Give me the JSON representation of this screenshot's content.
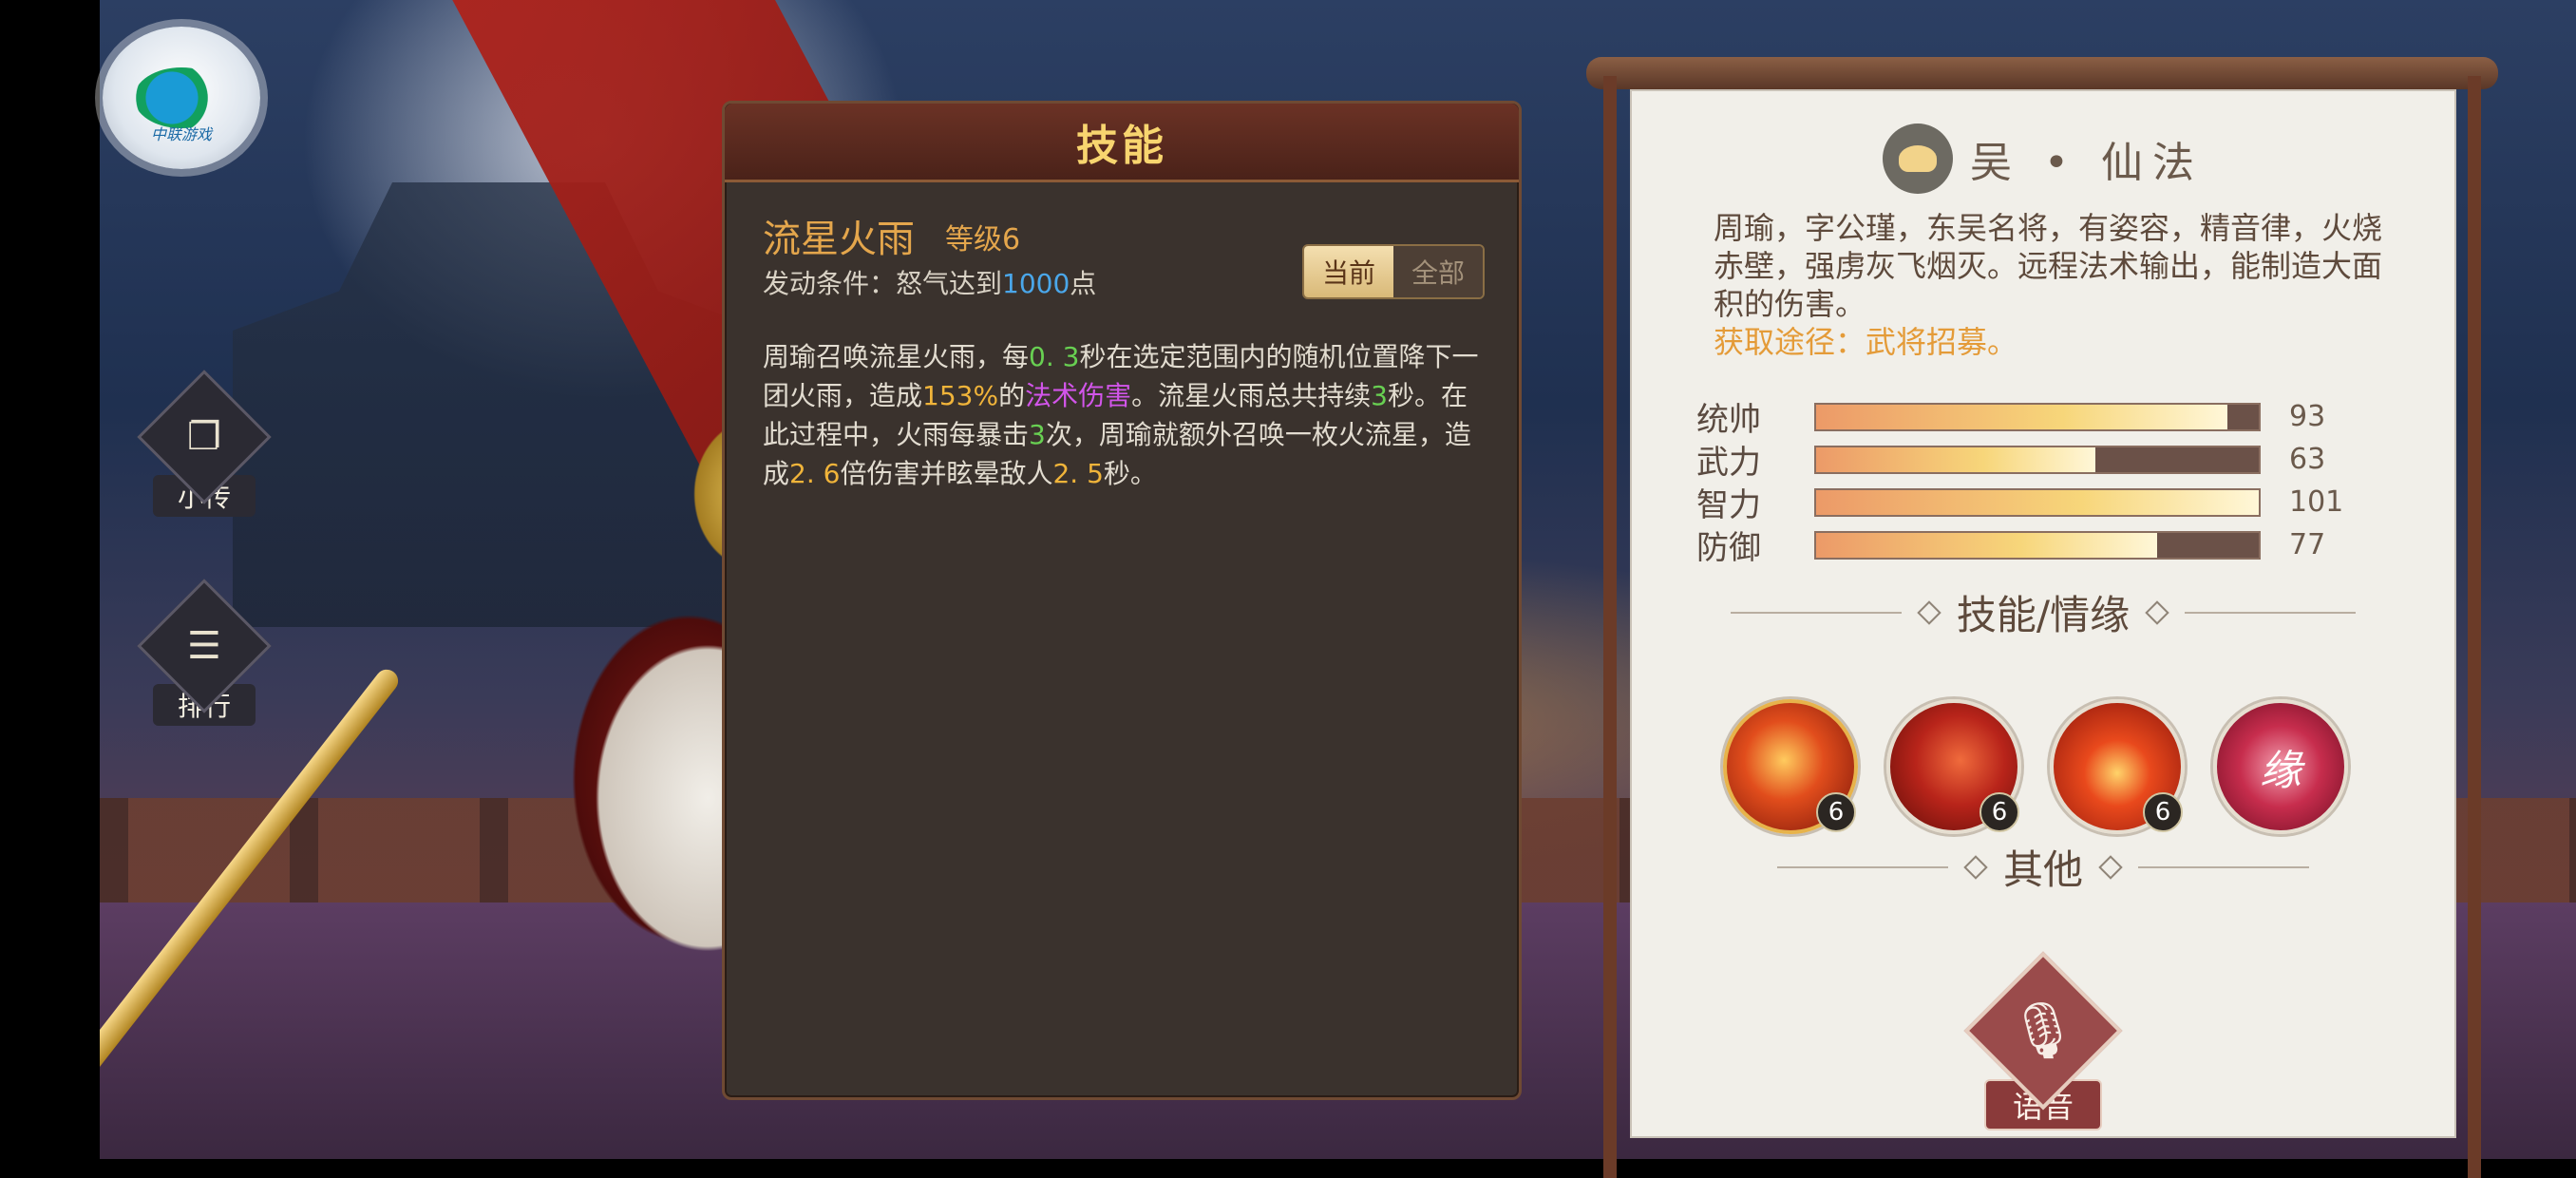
{
  "left": {
    "logo_text": "中联游戏",
    "side_buttons": [
      {
        "label": "小传",
        "icon": "book-cards-icon"
      },
      {
        "label": "排行",
        "icon": "scroll-ranking-icon"
      }
    ]
  },
  "skill_panel": {
    "title": "技能",
    "name": "流星火雨",
    "level": "等级6",
    "condition_prefix": "发动条件：怒气达到",
    "condition_value": "1000",
    "condition_suffix": "点",
    "tabs": [
      "当前",
      "全部"
    ],
    "active_tab": "当前",
    "desc": {
      "p1": "周瑜召唤流星火雨，每",
      "v1": "0. 3",
      "p2": "秒在选定范围内的随机位置降下一团火雨，造成",
      "v2": "153%",
      "p3": "的",
      "v3": "法术伤害",
      "p4": "。流星火雨总共持续",
      "v4": "3",
      "p5": "秒。在此过程中，火雨每暴击",
      "v5": "3",
      "p6": "次，周瑜就额外召唤一枚火流星，造成",
      "v6": "2. 6",
      "p7": "倍伤害并眩晕敌人",
      "v7": "2. 5",
      "p8": "秒。"
    }
  },
  "info_panel": {
    "faction": "吴 • 仙法",
    "bio": "周瑜，字公瑾，东吴名将，有姿容，精音律，火烧赤壁，强虏灰飞烟灭。远程法术输出，能制造大面积的伤害。",
    "source": "获取途径：武将招募。",
    "stats": [
      {
        "label": "统帅",
        "value": "93",
        "fill": 0.93
      },
      {
        "label": "武力",
        "value": "63",
        "fill": 0.63
      },
      {
        "label": "智力",
        "value": "101",
        "fill": 1.0
      },
      {
        "label": "防御",
        "value": "77",
        "fill": 0.77
      }
    ],
    "skills_title": "技能/情缘",
    "skills": [
      {
        "icon": "meteor-fire-icon",
        "level": "6"
      },
      {
        "icon": "fire-dragon-icon",
        "level": "6"
      },
      {
        "icon": "fire-ring-icon",
        "level": "6"
      },
      {
        "icon": "fate-heart-icon",
        "text": "缘"
      }
    ],
    "other_title": "其他",
    "voice_label": "语音"
  }
}
